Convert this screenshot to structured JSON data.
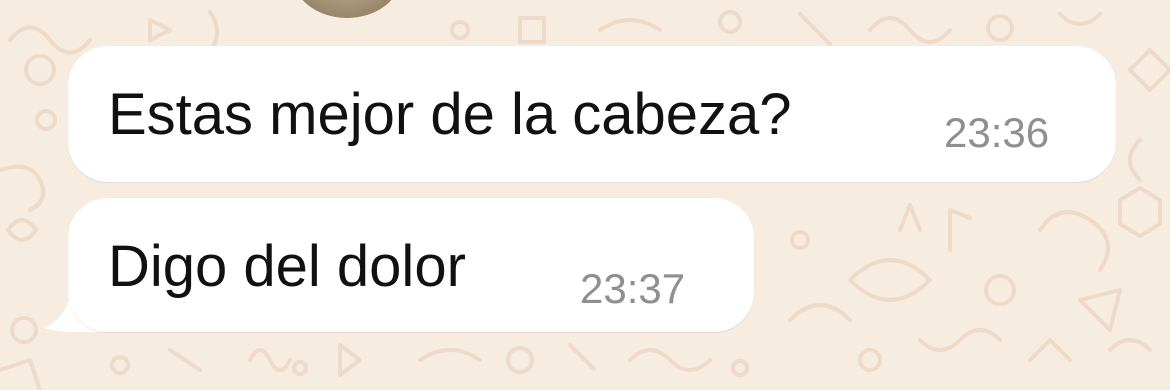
{
  "chat": {
    "messages": [
      {
        "text": "Estas mejor de la cabeza?",
        "time": "23:36"
      },
      {
        "text": "Digo del dolor",
        "time": "23:37"
      }
    ]
  },
  "colors": {
    "wallpaper": "#f6ece0",
    "doodle": "#eddac8",
    "bubble": "#ffffff",
    "message_text": "#111111",
    "timestamp": "#8e8e93"
  },
  "icons": [
    "contact-avatar",
    "wallpaper-doodles"
  ]
}
